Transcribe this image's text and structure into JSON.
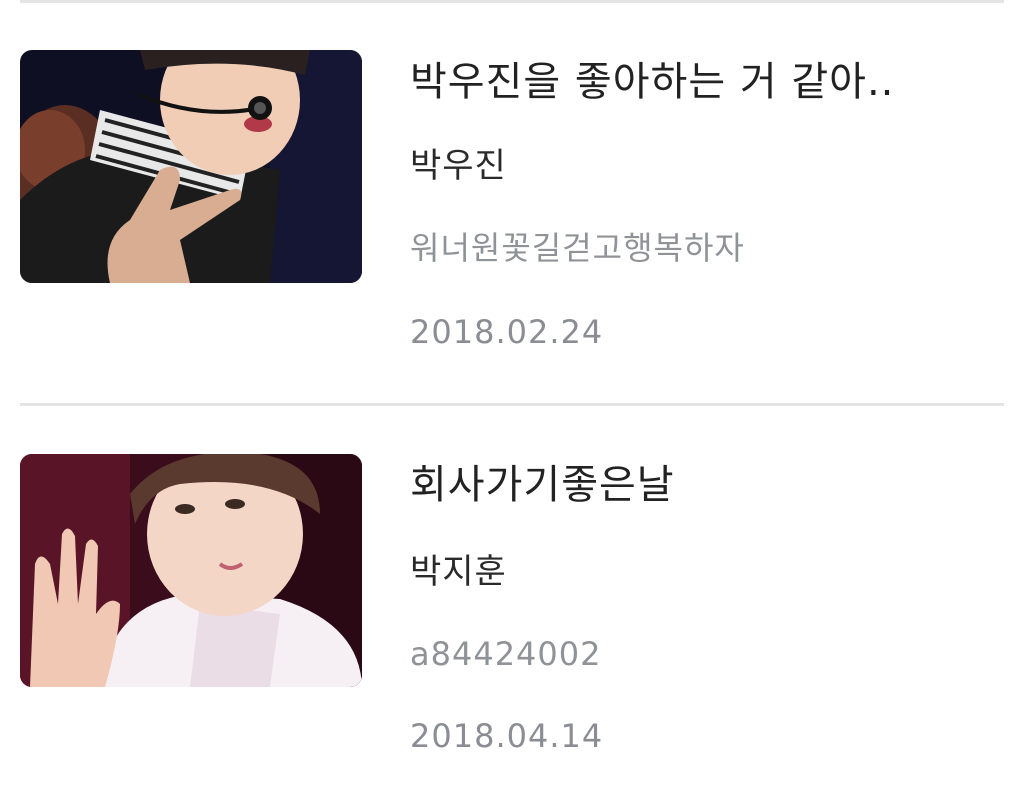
{
  "stories": [
    {
      "title": "박우진을 좋아하는 거 같아..",
      "author": "박우진",
      "writer": "워너원꽃길걷고행복하자",
      "date": "2018.02.24"
    },
    {
      "title": "회사가기좋은날",
      "author": "박지훈",
      "writer": "a84424002",
      "date": "2018.04.14"
    }
  ],
  "colors": {
    "title": "#222222",
    "meta": "#8f9398",
    "divider": "#e4e4e4"
  }
}
